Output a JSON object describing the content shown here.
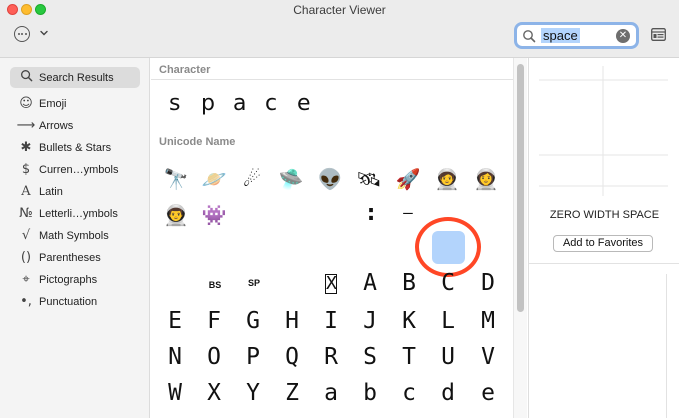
{
  "window": {
    "title": "Character Viewer"
  },
  "toolbar": {
    "more_icon": "ellipsis-circle-icon",
    "menu_icon": "chevron-down-icon",
    "search_value": "space",
    "search_icon": "magnifying-glass-icon",
    "clear_icon": "clear-circle-icon",
    "sidebar_toggle_icon": "sidebar-toggle-icon"
  },
  "sidebar": {
    "items": [
      {
        "label": "Search Results",
        "icon": "🔍",
        "icon_name": "search-icon",
        "selected": true
      },
      {
        "label": "Emoji",
        "icon": "☺",
        "icon_name": "smiley-icon"
      },
      {
        "label": "Arrows",
        "icon": "⟶",
        "icon_name": "arrow-icon"
      },
      {
        "label": "Bullets & Stars",
        "icon": "✱",
        "icon_name": "asterisk-icon"
      },
      {
        "label": "Curren…ymbols",
        "icon": "$",
        "icon_name": "dollar-icon"
      },
      {
        "label": "Latin",
        "icon": "A",
        "icon_name": "latin-a-icon"
      },
      {
        "label": "Letterli…ymbols",
        "icon": "№",
        "icon_name": "numero-icon"
      },
      {
        "label": "Math Symbols",
        "icon": "√",
        "icon_name": "square-root-icon"
      },
      {
        "label": "Parentheses",
        "icon": "()",
        "icon_name": "parentheses-icon"
      },
      {
        "label": "Pictographs",
        "icon": "⌖",
        "icon_name": "pictograph-icon"
      },
      {
        "label": "Punctuation",
        "icon": "•,",
        "icon_name": "punctuation-icon"
      }
    ]
  },
  "main": {
    "character_label": "Character",
    "character_letters": [
      "s",
      "p",
      "a",
      "c",
      "e"
    ],
    "unicode_name_label": "Unicode Name",
    "emoji_row1": [
      {
        "glyph": "🔭",
        "name": "telescope-icon"
      },
      {
        "glyph": "🪐",
        "name": "ringed-planet-icon"
      },
      {
        "glyph": "☄",
        "name": "comet-icon"
      },
      {
        "glyph": "🛸",
        "name": "flying-saucer-icon"
      },
      {
        "glyph": "👽",
        "name": "alien-icon"
      },
      {
        "glyph": "🛰",
        "name": "satellite-icon"
      },
      {
        "glyph": "🚀",
        "name": "rocket-icon"
      },
      {
        "glyph": "🧑‍🚀",
        "name": "astronaut-icon"
      },
      {
        "glyph": "👩‍🚀",
        "name": "woman-astronaut-icon"
      }
    ],
    "emoji_row2": [
      {
        "glyph": "👨‍🚀",
        "name": "man-astronaut-icon"
      },
      {
        "glyph": "👾",
        "name": "space-invader-icon"
      }
    ],
    "row2_symbols": [
      ":",
      "—"
    ],
    "row3_labels": [
      "BS",
      "SP"
    ],
    "row3_glyphs": [
      "A",
      "B",
      "C",
      "D"
    ],
    "boxed_glyph": "X",
    "grid_rows": [
      [
        "E",
        "F",
        "G",
        "H",
        "I",
        "J",
        "K",
        "L",
        "M"
      ],
      [
        "N",
        "O",
        "P",
        "Q",
        "R",
        "S",
        "T",
        "U",
        "V"
      ],
      [
        "W",
        "X",
        "Y",
        "Z",
        "a",
        "b",
        "c",
        "d",
        "e"
      ]
    ]
  },
  "detail": {
    "character_name": "ZERO WIDTH SPACE",
    "favorites_button": "Add to Favorites"
  },
  "colors": {
    "selection": "#b3d4fc",
    "annotation_ring": "#ff4726",
    "search_focus": "#8db4e8"
  }
}
